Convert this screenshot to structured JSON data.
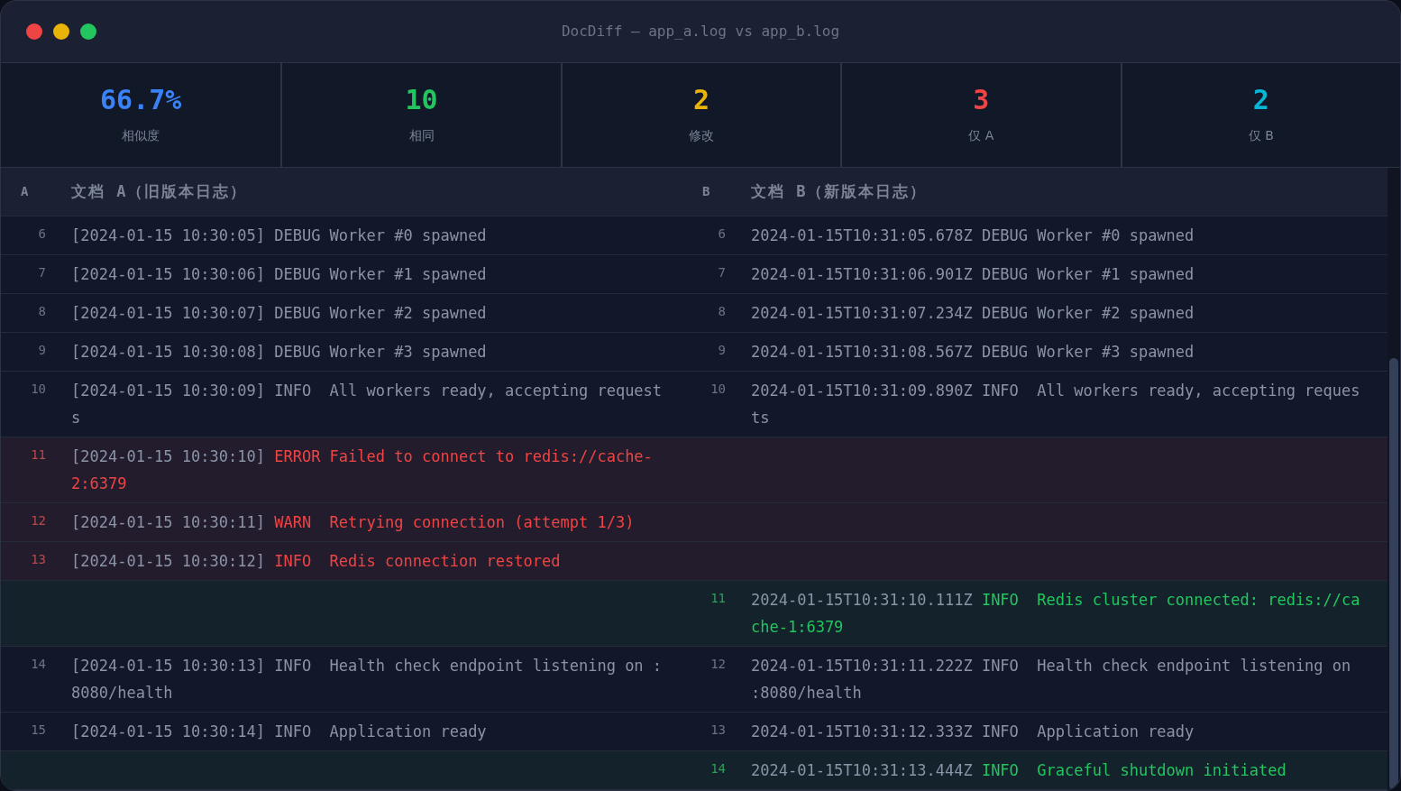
{
  "window": {
    "title": "DocDiff — app_a.log vs app_b.log"
  },
  "stats": [
    {
      "value": "66.7%",
      "label": "相似度",
      "color": "#3b82f6"
    },
    {
      "value": "10",
      "label": "相同",
      "color": "#22c55e"
    },
    {
      "value": "2",
      "label": "修改",
      "color": "#eab308"
    },
    {
      "value": "3",
      "label": "仅 A",
      "color": "#ef4444"
    },
    {
      "value": "2",
      "label": "仅 B",
      "color": "#06b6d4"
    }
  ],
  "header": {
    "a": {
      "tag": "A",
      "title": "文档 A（旧版本日志）"
    },
    "b": {
      "tag": "B",
      "title": "文档 B（新版本日志）"
    }
  },
  "rows": [
    {
      "kind": "same",
      "a": {
        "num": "6",
        "time": "[2024-01-15 10:30:05]",
        "level": "DEBUG",
        "message": "Worker #0 spawned"
      },
      "b": {
        "num": "6",
        "time": "2024-01-15T10:31:05.678Z",
        "level": "DEBUG",
        "message": "Worker #0 spawned"
      }
    },
    {
      "kind": "same",
      "a": {
        "num": "7",
        "time": "[2024-01-15 10:30:06]",
        "level": "DEBUG",
        "message": "Worker #1 spawned"
      },
      "b": {
        "num": "7",
        "time": "2024-01-15T10:31:06.901Z",
        "level": "DEBUG",
        "message": "Worker #1 spawned"
      }
    },
    {
      "kind": "same",
      "a": {
        "num": "8",
        "time": "[2024-01-15 10:30:07]",
        "level": "DEBUG",
        "message": "Worker #2 spawned"
      },
      "b": {
        "num": "8",
        "time": "2024-01-15T10:31:07.234Z",
        "level": "DEBUG",
        "message": "Worker #2 spawned"
      }
    },
    {
      "kind": "same",
      "a": {
        "num": "9",
        "time": "[2024-01-15 10:30:08]",
        "level": "DEBUG",
        "message": "Worker #3 spawned"
      },
      "b": {
        "num": "9",
        "time": "2024-01-15T10:31:08.567Z",
        "level": "DEBUG",
        "message": "Worker #3 spawned"
      }
    },
    {
      "kind": "same",
      "a": {
        "num": "10",
        "time": "[2024-01-15 10:30:09]",
        "level": "INFO",
        "message": "All workers ready, accepting requests"
      },
      "b": {
        "num": "10",
        "time": "2024-01-15T10:31:09.890Z",
        "level": "INFO",
        "message": "All workers ready, accepting requests"
      }
    },
    {
      "kind": "removed",
      "a": {
        "num": "11",
        "time": "[2024-01-15 10:30:10]",
        "level": "ERROR",
        "message": "Failed to connect to redis://cache-2:6379"
      }
    },
    {
      "kind": "removed",
      "a": {
        "num": "12",
        "time": "[2024-01-15 10:30:11]",
        "level": "WARN",
        "message": "Retrying connection (attempt 1/3)"
      }
    },
    {
      "kind": "removed",
      "a": {
        "num": "13",
        "time": "[2024-01-15 10:30:12]",
        "level": "INFO",
        "message": "Redis connection restored"
      }
    },
    {
      "kind": "added",
      "b": {
        "num": "11",
        "time": "2024-01-15T10:31:10.111Z",
        "level": "INFO",
        "message": "Redis cluster connected: redis://cache-1:6379"
      }
    },
    {
      "kind": "same",
      "a": {
        "num": "14",
        "time": "[2024-01-15 10:30:13]",
        "level": "INFO",
        "message": "Health check endpoint listening on :8080/health"
      },
      "b": {
        "num": "12",
        "time": "2024-01-15T10:31:11.222Z",
        "level": "INFO",
        "message": "Health check endpoint listening on :8080/health"
      }
    },
    {
      "kind": "same",
      "a": {
        "num": "15",
        "time": "[2024-01-15 10:30:14]",
        "level": "INFO",
        "message": "Application ready"
      },
      "b": {
        "num": "13",
        "time": "2024-01-15T10:31:12.333Z",
        "level": "INFO",
        "message": "Application ready"
      }
    },
    {
      "kind": "added",
      "b": {
        "num": "14",
        "time": "2024-01-15T10:31:13.444Z",
        "level": "INFO",
        "message": "Graceful shutdown initiated"
      }
    }
  ]
}
